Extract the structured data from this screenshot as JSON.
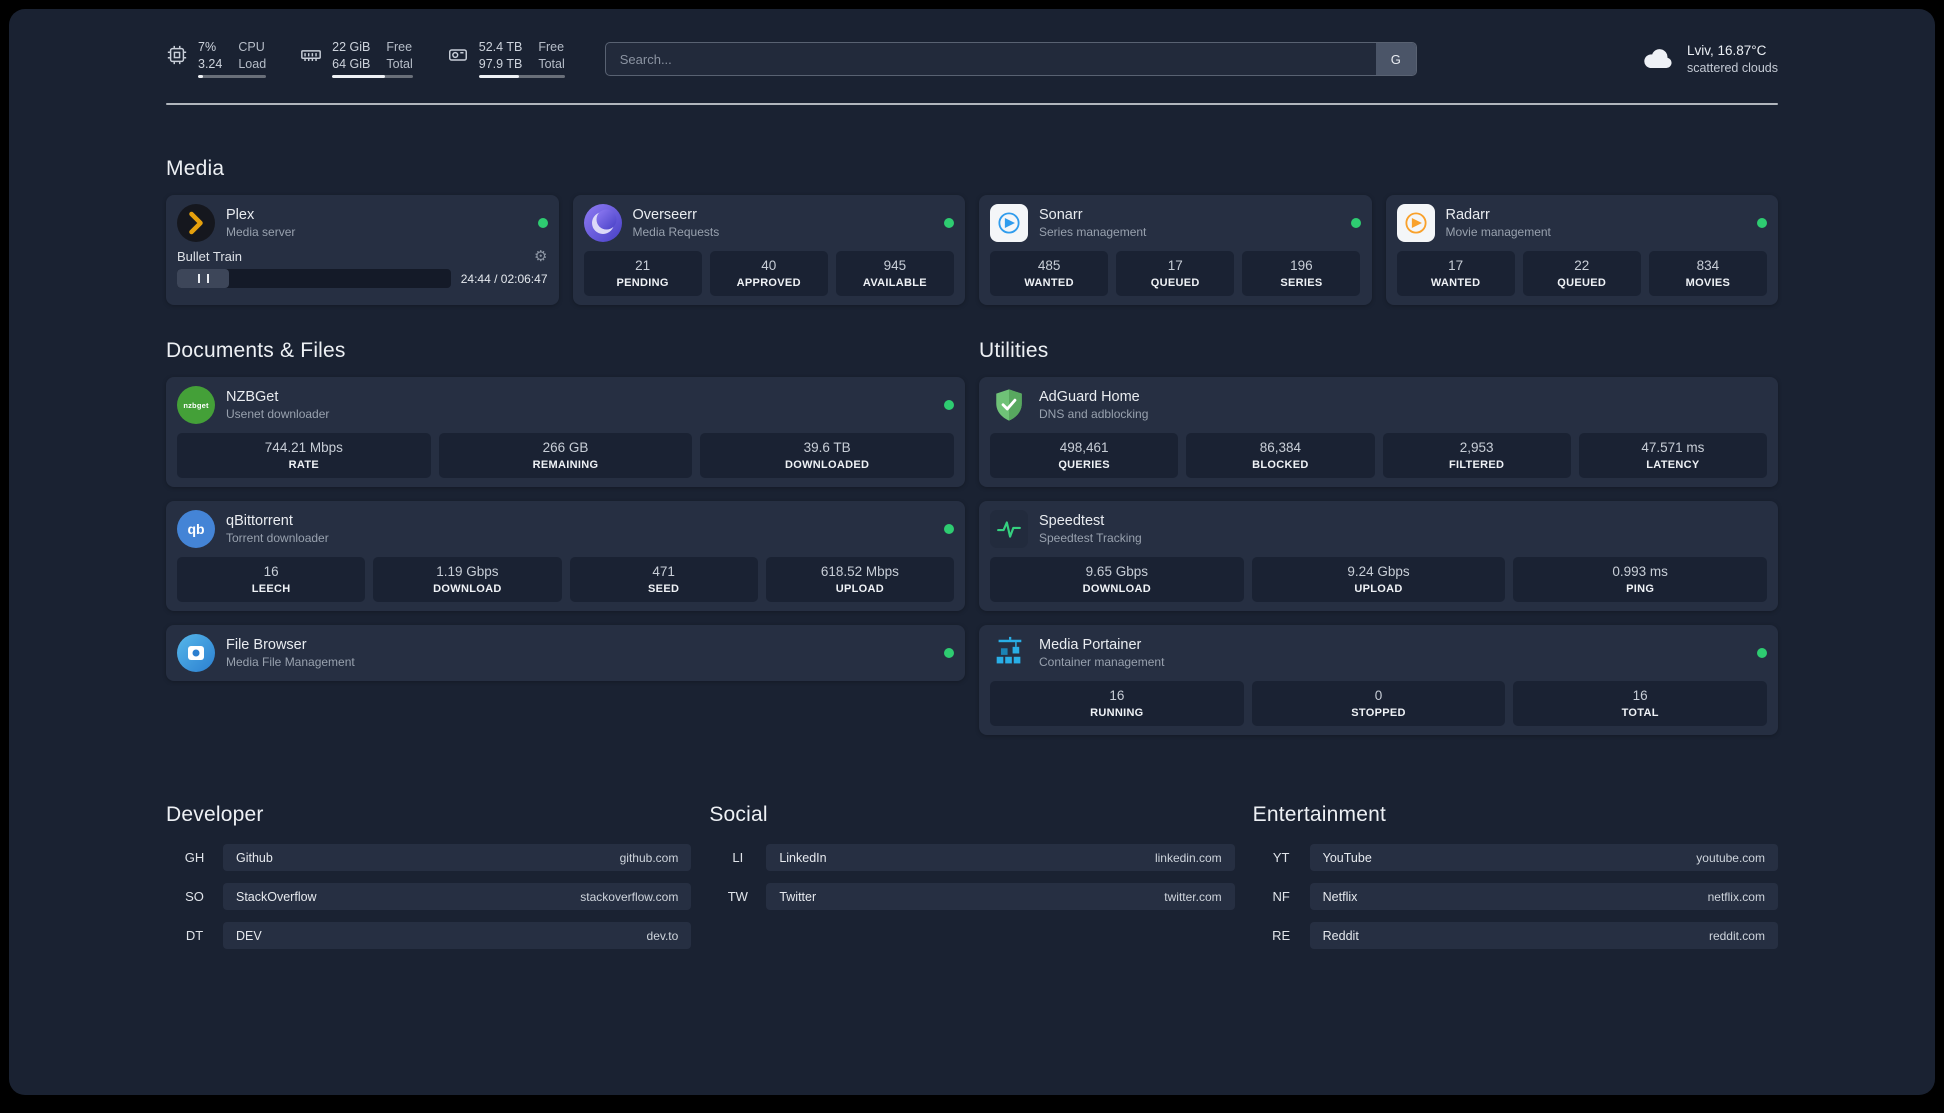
{
  "header": {
    "resources": [
      {
        "values": [
          "7%",
          "3.24"
        ],
        "labels": [
          "CPU",
          "Load"
        ],
        "progress": 7
      },
      {
        "values": [
          "22 GiB",
          "64 GiB"
        ],
        "labels": [
          "Free",
          "Total"
        ],
        "progress": 66
      },
      {
        "values": [
          "52.4 TB",
          "97.9 TB"
        ],
        "labels": [
          "Free",
          "Total"
        ],
        "progress": 47
      }
    ],
    "search": {
      "placeholder": "Search...",
      "provider": "G"
    },
    "weather": {
      "location": "Lviv, 16.87°C",
      "condition": "scattered clouds"
    }
  },
  "icons": {
    "gear_glyph": "⚙",
    "qbittorrent_glyph": "qb",
    "nzbget_glyph": "nzbget"
  },
  "colors": {
    "status_online": "#2ecc71",
    "plex_gold": "#e5a00d",
    "sonarr_blue": "#2f9ced",
    "radarr_orange": "#f9a12b",
    "portainer_blue": "#29aee6"
  },
  "sections": {
    "media": {
      "title": "Media",
      "plex": {
        "name": "Plex",
        "desc": "Media server",
        "now_playing": {
          "title": "Bullet Train",
          "time": "24:44 / 02:06:47",
          "progress": 19
        }
      },
      "overseerr": {
        "name": "Overseerr",
        "desc": "Media Requests",
        "stats": [
          {
            "value": "21",
            "label": "PENDING"
          },
          {
            "value": "40",
            "label": "APPROVED"
          },
          {
            "value": "945",
            "label": "AVAILABLE"
          }
        ]
      },
      "sonarr": {
        "name": "Sonarr",
        "desc": "Series management",
        "stats": [
          {
            "value": "485",
            "label": "WANTED"
          },
          {
            "value": "17",
            "label": "QUEUED"
          },
          {
            "value": "196",
            "label": "SERIES"
          }
        ]
      },
      "radarr": {
        "name": "Radarr",
        "desc": "Movie management",
        "stats": [
          {
            "value": "17",
            "label": "WANTED"
          },
          {
            "value": "22",
            "label": "QUEUED"
          },
          {
            "value": "834",
            "label": "MOVIES"
          }
        ]
      }
    },
    "documents": {
      "title": "Documents & Files",
      "nzbget": {
        "name": "NZBGet",
        "desc": "Usenet downloader",
        "stats": [
          {
            "value": "744.21 Mbps",
            "label": "RATE"
          },
          {
            "value": "266 GB",
            "label": "REMAINING"
          },
          {
            "value": "39.6 TB",
            "label": "DOWNLOADED"
          }
        ]
      },
      "qbittorrent": {
        "name": "qBittorrent",
        "desc": "Torrent downloader",
        "stats": [
          {
            "value": "16",
            "label": "LEECH"
          },
          {
            "value": "1.19 Gbps",
            "label": "DOWNLOAD"
          },
          {
            "value": "471",
            "label": "SEED"
          },
          {
            "value": "618.52 Mbps",
            "label": "UPLOAD"
          }
        ]
      },
      "filebrowser": {
        "name": "File Browser",
        "desc": "Media File Management"
      }
    },
    "utilities": {
      "title": "Utilities",
      "adguard": {
        "name": "AdGuard Home",
        "desc": "DNS and adblocking",
        "stats": [
          {
            "value": "498,461",
            "label": "QUERIES"
          },
          {
            "value": "86,384",
            "label": "BLOCKED"
          },
          {
            "value": "2,953",
            "label": "FILTERED"
          },
          {
            "value": "47.571 ms",
            "label": "LATENCY"
          }
        ]
      },
      "speedtest": {
        "name": "Speedtest",
        "desc": "Speedtest Tracking",
        "stats": [
          {
            "value": "9.65 Gbps",
            "label": "DOWNLOAD"
          },
          {
            "value": "9.24 Gbps",
            "label": "UPLOAD"
          },
          {
            "value": "0.993 ms",
            "label": "PING"
          }
        ]
      },
      "portainer": {
        "name": "Media Portainer",
        "desc": "Container management",
        "stats": [
          {
            "value": "16",
            "label": "RUNNING"
          },
          {
            "value": "0",
            "label": "STOPPED"
          },
          {
            "value": "16",
            "label": "TOTAL"
          }
        ]
      }
    },
    "bookmarks": [
      {
        "title": "Developer",
        "items": [
          {
            "abbr": "GH",
            "name": "Github",
            "url": "github.com"
          },
          {
            "abbr": "SO",
            "name": "StackOverflow",
            "url": "stackoverflow.com"
          },
          {
            "abbr": "DT",
            "name": "DEV",
            "url": "dev.to"
          }
        ]
      },
      {
        "title": "Social",
        "items": [
          {
            "abbr": "LI",
            "name": "LinkedIn",
            "url": "linkedin.com"
          },
          {
            "abbr": "TW",
            "name": "Twitter",
            "url": "twitter.com"
          }
        ]
      },
      {
        "title": "Entertainment",
        "items": [
          {
            "abbr": "YT",
            "name": "YouTube",
            "url": "youtube.com"
          },
          {
            "abbr": "NF",
            "name": "Netflix",
            "url": "netflix.com"
          },
          {
            "abbr": "RE",
            "name": "Reddit",
            "url": "reddit.com"
          }
        ]
      }
    ]
  }
}
